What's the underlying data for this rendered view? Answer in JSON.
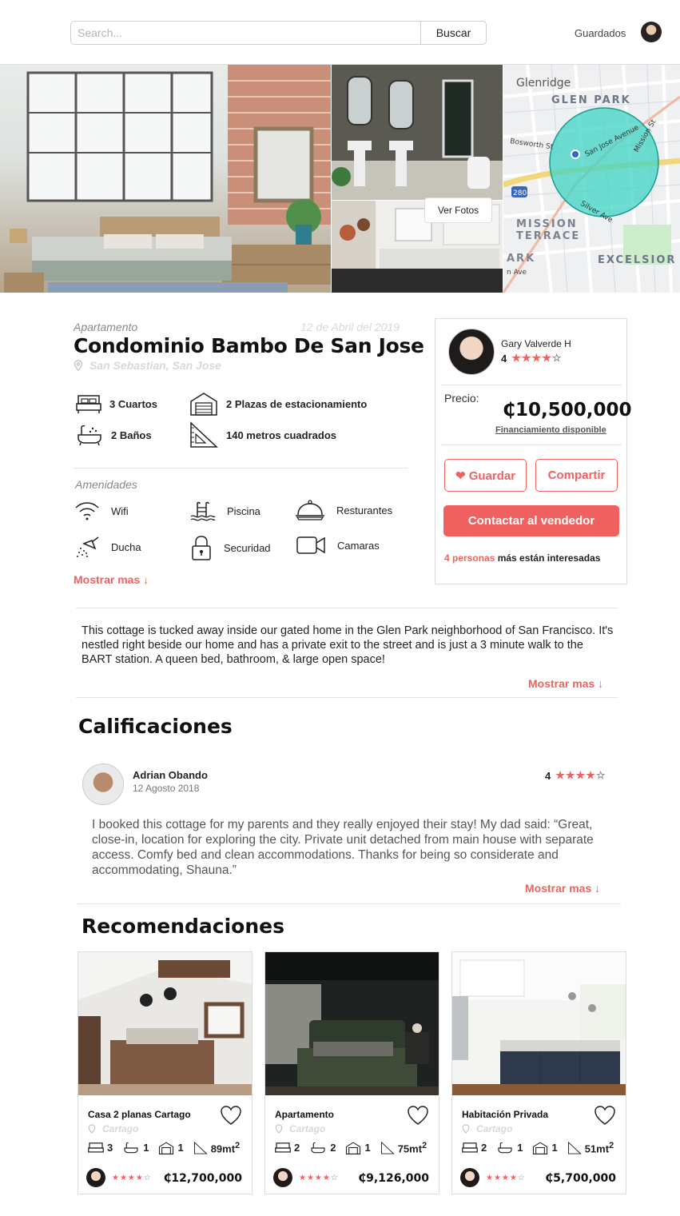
{
  "header": {
    "search_placeholder": "Search...",
    "search_button": "Buscar",
    "saved_link": "Guardados"
  },
  "gallery": {
    "view_photos_button": "Ver Fotos",
    "map_labels": [
      "Glenridge",
      "GLEN PARK",
      "Bosworth St",
      "San Jose Avenue",
      "Mission St",
      "280",
      "Silver Ave",
      "MISSION",
      "TERRACE",
      "ARK",
      "EXCELSIOR",
      "n Ave"
    ]
  },
  "listing": {
    "type": "Apartamento",
    "date": "12 de Abril del 2019",
    "title": "Condominio Bambo De San Jose",
    "location": "San Sebastian, San Jose",
    "features": {
      "rooms": "3 Cuartos",
      "baths": "2 Baños",
      "parking": "2 Plazas de estacionamiento",
      "area": "140 metros cuadrados"
    },
    "amenities_title": "Amenidades",
    "amenities": {
      "wifi": "Wifi",
      "pool": "Piscina",
      "restaurants": "Resturantes",
      "shower": "Ducha",
      "security": "Securidad",
      "cameras": "Camaras"
    },
    "show_more": "Mostrar mas ↓",
    "description": "This cottage is tucked away inside our gated home in the Glen Park neighborhood of San Francisco. It's nestled right beside our home and has a private exit to the street and is just a 3 minute walk to the BART station. A queen bed, bathroom, & large open space!",
    "description_more": "Mostrar mas ↓"
  },
  "seller": {
    "name": "Gary Valverde H",
    "rating": "4",
    "stars_filled": "★★★★",
    "stars_empty": "☆",
    "price_label": "Precio:",
    "price": "₵10,500,000",
    "financing": "Financiamiento disponible",
    "save_button": "❤ Guardar",
    "share_button": "Compartir",
    "contact_button": "Contactar al vendedor",
    "interest_count": "4 personas",
    "interest_text": " más están interesadas"
  },
  "reviews": {
    "title": "Calificaciones",
    "items": [
      {
        "name": "Adrian Obando",
        "date": "12 Agosto 2018",
        "rating": "4",
        "stars_filled": "★★★★",
        "stars_empty": "☆",
        "text": "I booked this cottage for my parents and they really enjoyed their stay! My dad said: “Great, close-in, location for exploring the city. Private unit detached from main house with separate access. Comfy bed and clean accommodations. Thanks for being so considerate and accommodating, Shauna.”",
        "show_more": "Mostrar mas ↓"
      }
    ]
  },
  "recommendations": {
    "title": "Recomendaciones",
    "items": [
      {
        "title": "Casa 2 planas Cartago",
        "location": "Cartago",
        "beds": "3",
        "baths": "1",
        "garage": "1",
        "area": "89mt",
        "area_sup": "2",
        "stars_filled": "★★★★",
        "stars_empty": "☆",
        "price": "₵12,700,000"
      },
      {
        "title": "Apartamento",
        "location": "Cartago",
        "beds": "2",
        "baths": "2",
        "garage": "1",
        "area": "75mt",
        "area_sup": "2",
        "stars_filled": "★★★★",
        "stars_empty": "☆",
        "price": "₵9,126,000"
      },
      {
        "title": "Habitación Privada",
        "location": "Cartago",
        "beds": "2",
        "baths": "1",
        "garage": "1",
        "area": "51mt",
        "area_sup": "2",
        "stars_filled": "★★★★",
        "stars_empty": "☆",
        "price": "₵5,700,000"
      }
    ]
  },
  "colors": {
    "accent": "#f0625f",
    "map_circle": "#3fd4c4",
    "muted_text": "#d8d8d8"
  }
}
